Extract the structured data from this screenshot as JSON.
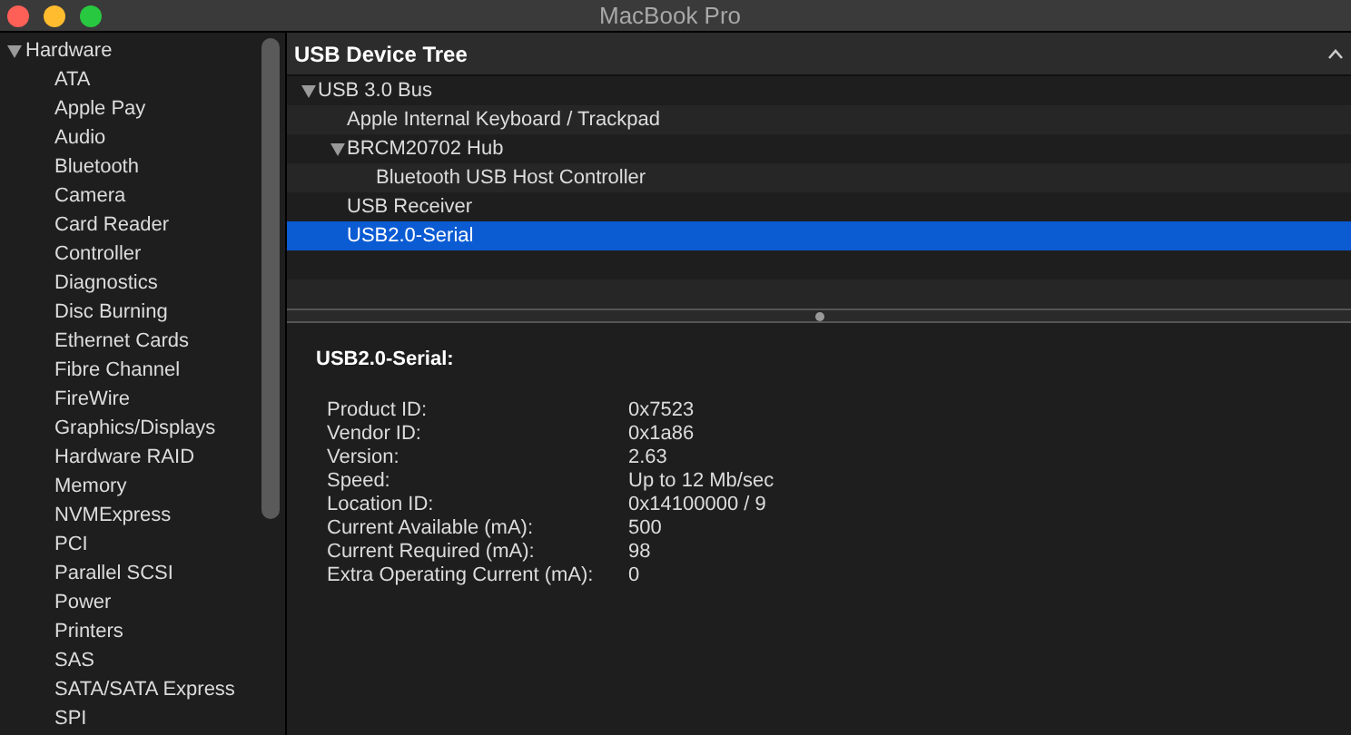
{
  "window": {
    "title": "MacBook Pro"
  },
  "sidebar": {
    "items": [
      {
        "label": "Hardware",
        "expanded": true,
        "children": [
          {
            "label": "ATA"
          },
          {
            "label": "Apple Pay"
          },
          {
            "label": "Audio"
          },
          {
            "label": "Bluetooth"
          },
          {
            "label": "Camera"
          },
          {
            "label": "Card Reader"
          },
          {
            "label": "Controller"
          },
          {
            "label": "Diagnostics"
          },
          {
            "label": "Disc Burning"
          },
          {
            "label": "Ethernet Cards"
          },
          {
            "label": "Fibre Channel"
          },
          {
            "label": "FireWire"
          },
          {
            "label": "Graphics/Displays"
          },
          {
            "label": "Hardware RAID"
          },
          {
            "label": "Memory"
          },
          {
            "label": "NVMExpress"
          },
          {
            "label": "PCI"
          },
          {
            "label": "Parallel SCSI"
          },
          {
            "label": "Power"
          },
          {
            "label": "Printers"
          },
          {
            "label": "SAS"
          },
          {
            "label": "SATA/SATA Express"
          },
          {
            "label": "SPI"
          }
        ]
      }
    ]
  },
  "tree": {
    "title": "USB Device Tree",
    "items": [
      {
        "label": "USB 3.0 Bus",
        "selected": false,
        "expanded": true,
        "children": [
          {
            "label": "Apple Internal Keyboard / Trackpad",
            "selected": false
          },
          {
            "label": "BRCM20702 Hub",
            "selected": false,
            "expanded": true,
            "children": [
              {
                "label": "Bluetooth USB Host Controller",
                "selected": false
              }
            ]
          },
          {
            "label": "USB Receiver",
            "selected": false
          },
          {
            "label": "USB2.0-Serial",
            "selected": true
          }
        ]
      }
    ]
  },
  "details": {
    "title": "USB2.0-Serial:",
    "properties": [
      {
        "label": "Product ID:",
        "value": "0x7523"
      },
      {
        "label": "Vendor ID:",
        "value": "0x1a86"
      },
      {
        "label": "Version:",
        "value": "2.63"
      },
      {
        "label": "Speed:",
        "value": "Up to 12 Mb/sec"
      },
      {
        "label": "Location ID:",
        "value": "0x14100000 / 9"
      },
      {
        "label": "Current Available (mA):",
        "value": "500"
      },
      {
        "label": "Current Required (mA):",
        "value": "98"
      },
      {
        "label": "Extra Operating Current (mA):",
        "value": "0"
      }
    ]
  }
}
